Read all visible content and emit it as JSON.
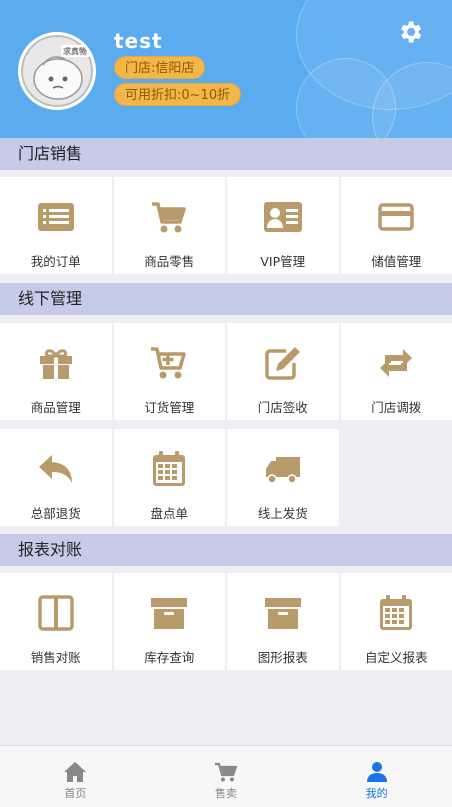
{
  "profile": {
    "username": "test",
    "store_label": "门店:信阳店",
    "discount_label": "可用折扣:0~10折",
    "avatar_text": "求真物"
  },
  "colors": {
    "header_bg": "#5aabf0",
    "section_bg": "#c6cbe7",
    "icon": "#b99b6b",
    "badge": "#f4b64a",
    "active_tab": "#1a73e8"
  },
  "sections": [
    {
      "title": "门店销售",
      "rows": [
        [
          {
            "label": "我的订单",
            "icon": "list-card-icon"
          },
          {
            "label": "商品零售",
            "icon": "cart-icon"
          },
          {
            "label": "VIP管理",
            "icon": "id-card-icon"
          },
          {
            "label": "储值管理",
            "icon": "credit-card-icon"
          }
        ]
      ]
    },
    {
      "title": "线下管理",
      "rows": [
        [
          {
            "label": "商品管理",
            "icon": "gift-icon"
          },
          {
            "label": "订货管理",
            "icon": "cart-plus-icon"
          },
          {
            "label": "门店签收",
            "icon": "edit-icon"
          },
          {
            "label": "门店调拨",
            "icon": "transfer-icon"
          }
        ],
        [
          {
            "label": "总部退货",
            "icon": "reply-icon"
          },
          {
            "label": "盘点单",
            "icon": "calendar-icon"
          },
          {
            "label": "线上发货",
            "icon": "truck-icon"
          }
        ]
      ]
    },
    {
      "title": "报表对账",
      "rows": [
        [
          {
            "label": "销售对账",
            "icon": "columns-icon"
          },
          {
            "label": "库存查询",
            "icon": "archive-icon"
          },
          {
            "label": "图形报表",
            "icon": "archive-icon"
          },
          {
            "label": "自定义报表",
            "icon": "calendar-icon"
          }
        ]
      ]
    }
  ],
  "tabs": [
    {
      "label": "首页",
      "icon": "home-icon",
      "active": false
    },
    {
      "label": "售卖",
      "icon": "cart-icon",
      "active": false
    },
    {
      "label": "我的",
      "icon": "user-icon",
      "active": true
    }
  ]
}
